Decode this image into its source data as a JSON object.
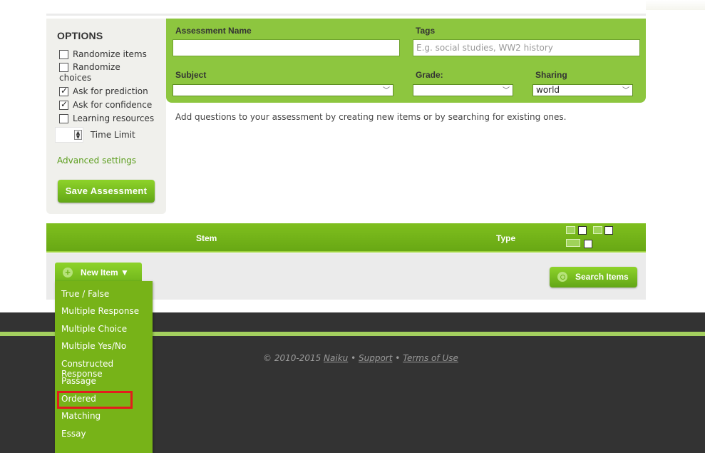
{
  "options": {
    "title": "OPTIONS",
    "randomize_items": "Randomize items",
    "randomize_choices_line1": "Randomize",
    "randomize_choices_line2": "choices",
    "ask_prediction": "Ask for prediction",
    "ask_confidence": "Ask for confidence",
    "learning_resources": "Learning resources",
    "time_limit": "Time Limit",
    "advanced_settings": "Advanced settings",
    "save_button": "Save Assessment"
  },
  "form": {
    "assessment_name_label": "Assessment Name",
    "assessment_name_value": "",
    "tags_label": "Tags",
    "tags_placeholder": "E.g. social studies, WW2 history",
    "subject_label": "Subject",
    "subject_value": "",
    "grade_label": "Grade:",
    "grade_value": "",
    "sharing_label": "Sharing",
    "sharing_value": "world"
  },
  "help_text": "Add questions to your assessment by creating new items or by searching for existing ones.",
  "table": {
    "stem_header": "Stem",
    "type_header": "Type"
  },
  "actions": {
    "new_item": "New Item ▼",
    "search_items": "Search Items"
  },
  "menu": {
    "items": [
      "True / False",
      "Multiple Response",
      "Multiple Choice",
      "Multiple Yes/No",
      "Constructed Response",
      "Passage",
      "Ordered",
      "Matching",
      "Essay"
    ],
    "highlighted": "Ordered",
    "highlight_color": "#e21c1c"
  },
  "footer": {
    "copyright": "© 2010-2015 ",
    "naiku": "Naiku",
    "sep": " • ",
    "support": "Support",
    "terms": "Terms of Use"
  },
  "colors": {
    "brand_green": "#8dc63f",
    "dark_footer": "#333333"
  }
}
